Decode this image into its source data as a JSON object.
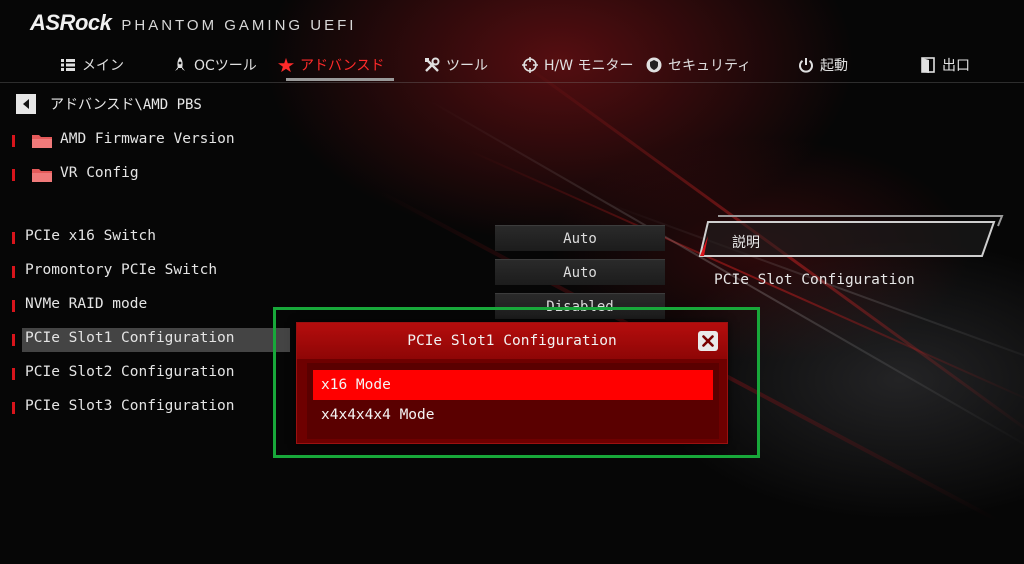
{
  "brand": {
    "logo": "ASRock",
    "subtitle": "PHANTOM GAMING UEFI"
  },
  "nav": {
    "items": [
      {
        "label": "メイン",
        "icon": "list-icon"
      },
      {
        "label": "OCツール",
        "icon": "rocket-icon"
      },
      {
        "label": "アドバンスド",
        "icon": "star-icon",
        "active": true
      },
      {
        "label": "ツール",
        "icon": "tools-icon"
      },
      {
        "label": "H/W モニター",
        "icon": "crosshair-icon"
      },
      {
        "label": "セキュリティ",
        "icon": "shield-icon"
      },
      {
        "label": "起動",
        "icon": "power-icon"
      },
      {
        "label": "出口",
        "icon": "exit-door-icon"
      }
    ]
  },
  "breadcrumb": {
    "path": "アドバンスド\\AMD PBS"
  },
  "folders": [
    {
      "label": "AMD Firmware Version"
    },
    {
      "label": "VR Config"
    }
  ],
  "options": [
    {
      "label": "PCIe x16 Switch",
      "value": "Auto"
    },
    {
      "label": "Promontory PCIe Switch",
      "value": "Auto"
    },
    {
      "label": "NVMe RAID mode",
      "value": "Disabled"
    },
    {
      "label": "PCIe Slot1 Configuration",
      "value": ""
    },
    {
      "label": "PCIe Slot2 Configuration",
      "value": ""
    },
    {
      "label": "PCIe Slot3 Configuration",
      "value": ""
    }
  ],
  "description": {
    "title": "説明",
    "text": "PCIe Slot Configuration"
  },
  "popup": {
    "title": "PCIe Slot1 Configuration",
    "options": [
      {
        "label": "x16 Mode",
        "selected": true
      },
      {
        "label": "x4x4x4x4 Mode",
        "selected": false
      }
    ]
  },
  "colors": {
    "accent": "#ff2a2a",
    "popup_header": "#b50d0d",
    "popup_selected": "#ff0000",
    "highlight_frame": "#18a83a"
  }
}
